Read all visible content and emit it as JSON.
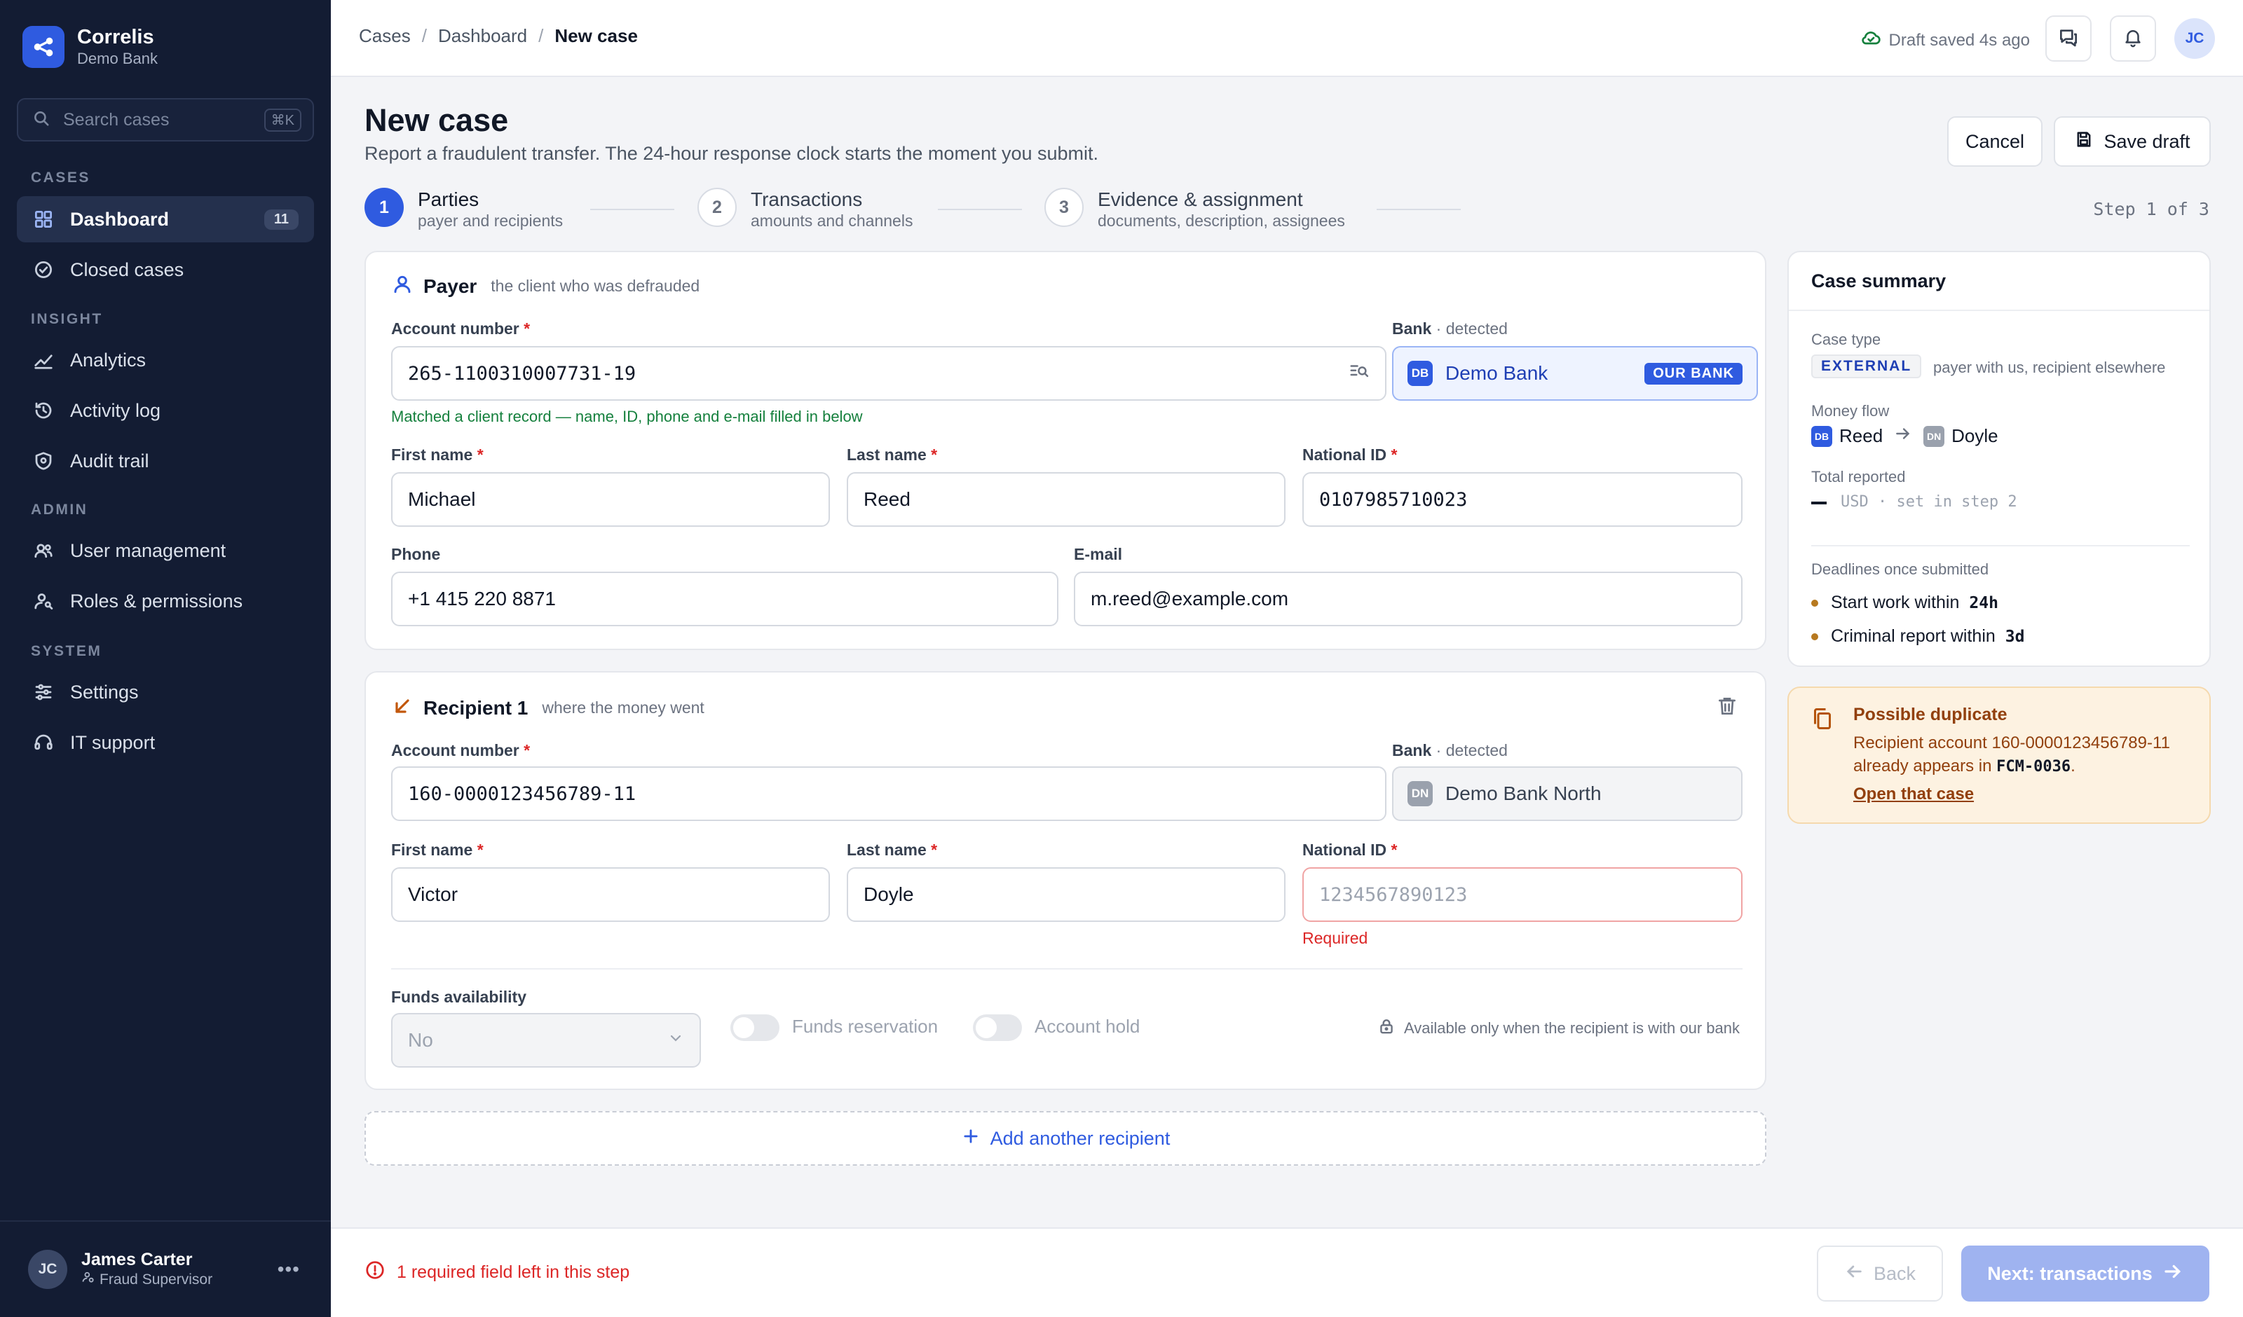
{
  "app": {
    "name": "Correlis",
    "org": "Demo Bank"
  },
  "search": {
    "placeholder": "Search cases",
    "shortcut": "⌘K"
  },
  "nav": {
    "sections": [
      "CASES",
      "INSIGHT",
      "ADMIN",
      "SYSTEM"
    ],
    "items": [
      {
        "label": "Dashboard",
        "badge": "11",
        "icon": "grid-icon",
        "active": true
      },
      {
        "label": "Closed cases",
        "icon": "check-circle-icon"
      },
      {
        "label": "Analytics",
        "icon": "trend-icon"
      },
      {
        "label": "Activity log",
        "icon": "history-icon"
      },
      {
        "label": "Audit trail",
        "icon": "shield-icon"
      },
      {
        "label": "User management",
        "icon": "users-icon"
      },
      {
        "label": "Roles & permissions",
        "icon": "user-key-icon"
      },
      {
        "label": "Settings",
        "icon": "sliders-icon"
      },
      {
        "label": "IT support",
        "icon": "headset-icon"
      }
    ]
  },
  "user": {
    "initials": "JC",
    "name": "James Carter",
    "role": "Fraud Supervisor"
  },
  "topbar": {
    "breadcrumb": [
      "Cases",
      "Dashboard",
      "New case"
    ],
    "draft_status": "Draft saved 4s ago",
    "avatar": "JC"
  },
  "page": {
    "title": "New case",
    "subtitle": "Report a fraudulent transfer. The 24-hour response clock starts the moment you submit.",
    "cancel": "Cancel",
    "save_draft": "Save draft"
  },
  "stepper": {
    "steps": [
      {
        "num": "1",
        "title": "Parties",
        "sub": "payer and recipients"
      },
      {
        "num": "2",
        "title": "Transactions",
        "sub": "amounts and channels"
      },
      {
        "num": "3",
        "title": "Evidence & assignment",
        "sub": "documents, description, assignees"
      }
    ],
    "progress": "Step 1 of 3"
  },
  "payer": {
    "title": "Payer",
    "subtitle": "the client who was defrauded",
    "account_label": "Account number",
    "account_value": "265-1100310007731-19",
    "bank_label": "Bank",
    "bank_detected": " · detected",
    "bank_name": "Demo Bank",
    "bank_chip": "DB",
    "our_bank": "OUR BANK",
    "match_hint": "Matched a client record — name, ID, phone and e-mail filled in below",
    "first_name_label": "First name",
    "first_name": "Michael",
    "last_name_label": "Last name",
    "last_name": "Reed",
    "national_id_label": "National ID",
    "national_id": "0107985710023",
    "phone_label": "Phone",
    "phone": "+1 415 220 8871",
    "email_label": "E-mail",
    "email": "m.reed@example.com"
  },
  "recipient": {
    "title": "Recipient 1",
    "subtitle": "where the money went",
    "account_label": "Account number",
    "account_value": "160-0000123456789-11",
    "bank_label": "Bank",
    "bank_detected": " · detected",
    "bank_name": "Demo Bank North",
    "bank_chip": "DN",
    "first_name_label": "First name",
    "first_name": "Victor",
    "last_name_label": "Last name",
    "last_name": "Doyle",
    "national_id_label": "National ID",
    "national_id_placeholder": "1234567890123",
    "national_id_error": "Required",
    "funds_label": "Funds availability",
    "funds_value": "No",
    "toggle_reservation": "Funds reservation",
    "toggle_hold": "Account hold",
    "lock_note": "Available only when the recipient is with our bank"
  },
  "add_recipient": "Add another recipient",
  "summary": {
    "title": "Case summary",
    "case_type_label": "Case type",
    "case_type": "EXTERNAL",
    "case_type_desc": "payer with us, recipient elsewhere",
    "money_flow_label": "Money flow",
    "from": "Reed",
    "from_chip": "DB",
    "to": "Doyle",
    "to_chip": "DN",
    "total_label": "Total reported",
    "total_value": "USD · set in step 2",
    "deadlines_label": "Deadlines once submitted",
    "deadlines": [
      {
        "label": "Start work within",
        "value": "24h"
      },
      {
        "label": "Criminal report within",
        "value": "3d"
      }
    ]
  },
  "duplicate": {
    "title": "Possible duplicate",
    "text_before": "Recipient account 160-0000123456789-11 already appears in ",
    "case_id": "FCM-0036",
    "text_after": ".",
    "link": "Open that case"
  },
  "footer": {
    "warning": "1 required field left in this step",
    "back": "Back",
    "next": "Next: transactions"
  },
  "colors": {
    "accent": "#2f5be0",
    "sidebar": "#131c33",
    "error": "#dc2626",
    "success": "#15803d",
    "warning_bg": "#fdf2e1"
  }
}
